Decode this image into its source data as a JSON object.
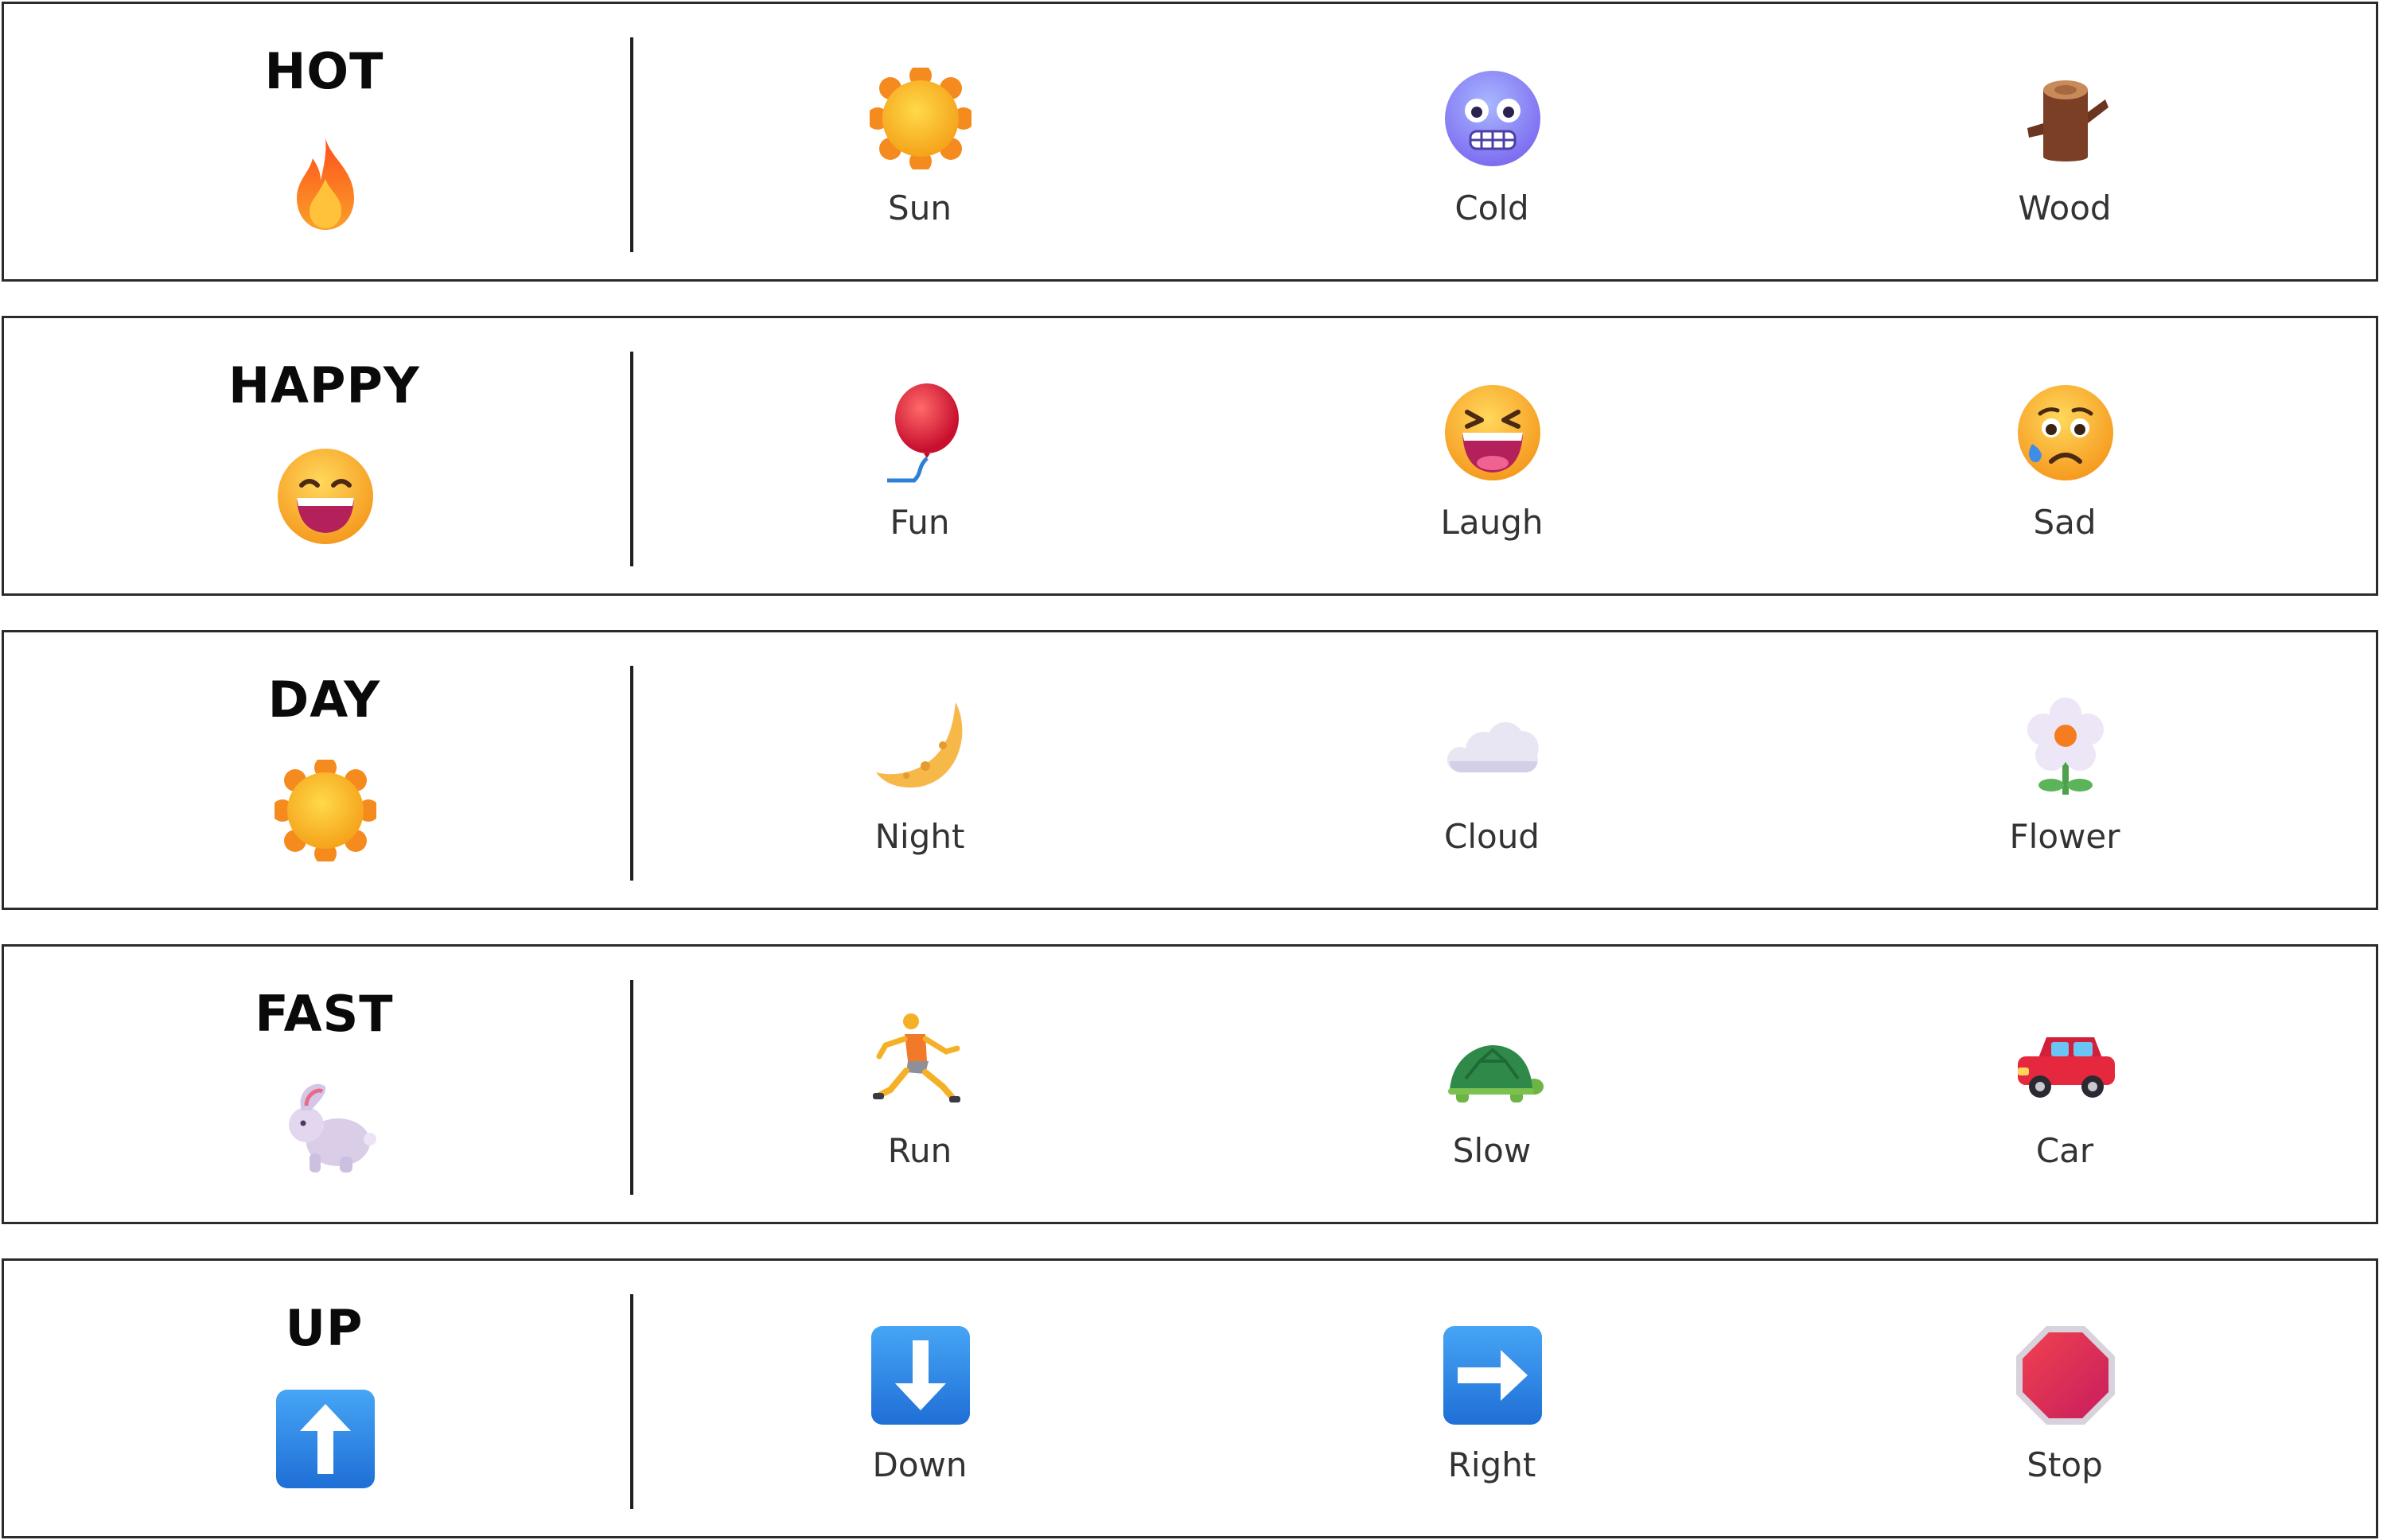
{
  "rows": [
    {
      "word": "HOT",
      "icon": "fire-icon",
      "options": [
        {
          "label": "Sun",
          "icon": "sun-icon"
        },
        {
          "label": "Cold",
          "icon": "cold-face-icon"
        },
        {
          "label": "Wood",
          "icon": "wood-log-icon"
        }
      ]
    },
    {
      "word": "HAPPY",
      "icon": "grinning-face-icon",
      "options": [
        {
          "label": "Fun",
          "icon": "balloon-icon"
        },
        {
          "label": "Laugh",
          "icon": "laughing-face-icon"
        },
        {
          "label": "Sad",
          "icon": "sad-face-icon"
        }
      ]
    },
    {
      "word": "DAY",
      "icon": "sun-icon",
      "options": [
        {
          "label": "Night",
          "icon": "crescent-moon-icon"
        },
        {
          "label": "Cloud",
          "icon": "cloud-icon"
        },
        {
          "label": "Flower",
          "icon": "flower-icon"
        }
      ]
    },
    {
      "word": "FAST",
      "icon": "rabbit-icon",
      "options": [
        {
          "label": "Run",
          "icon": "runner-icon"
        },
        {
          "label": "Slow",
          "icon": "turtle-icon"
        },
        {
          "label": "Car",
          "icon": "car-icon"
        }
      ]
    },
    {
      "word": "UP",
      "icon": "up-arrow-icon",
      "options": [
        {
          "label": "Down",
          "icon": "down-arrow-icon"
        },
        {
          "label": "Right",
          "icon": "right-arrow-icon"
        },
        {
          "label": "Stop",
          "icon": "stop-sign-icon"
        }
      ]
    }
  ],
  "colors": {
    "border": "#2b2b2b",
    "word_text": "#0a0a0a",
    "label_text": "#333333",
    "sun": "#f6b21b",
    "fire": "#f45c1f",
    "arrow_blue": "#2f8ae8",
    "stop_red": "#d9263f"
  }
}
